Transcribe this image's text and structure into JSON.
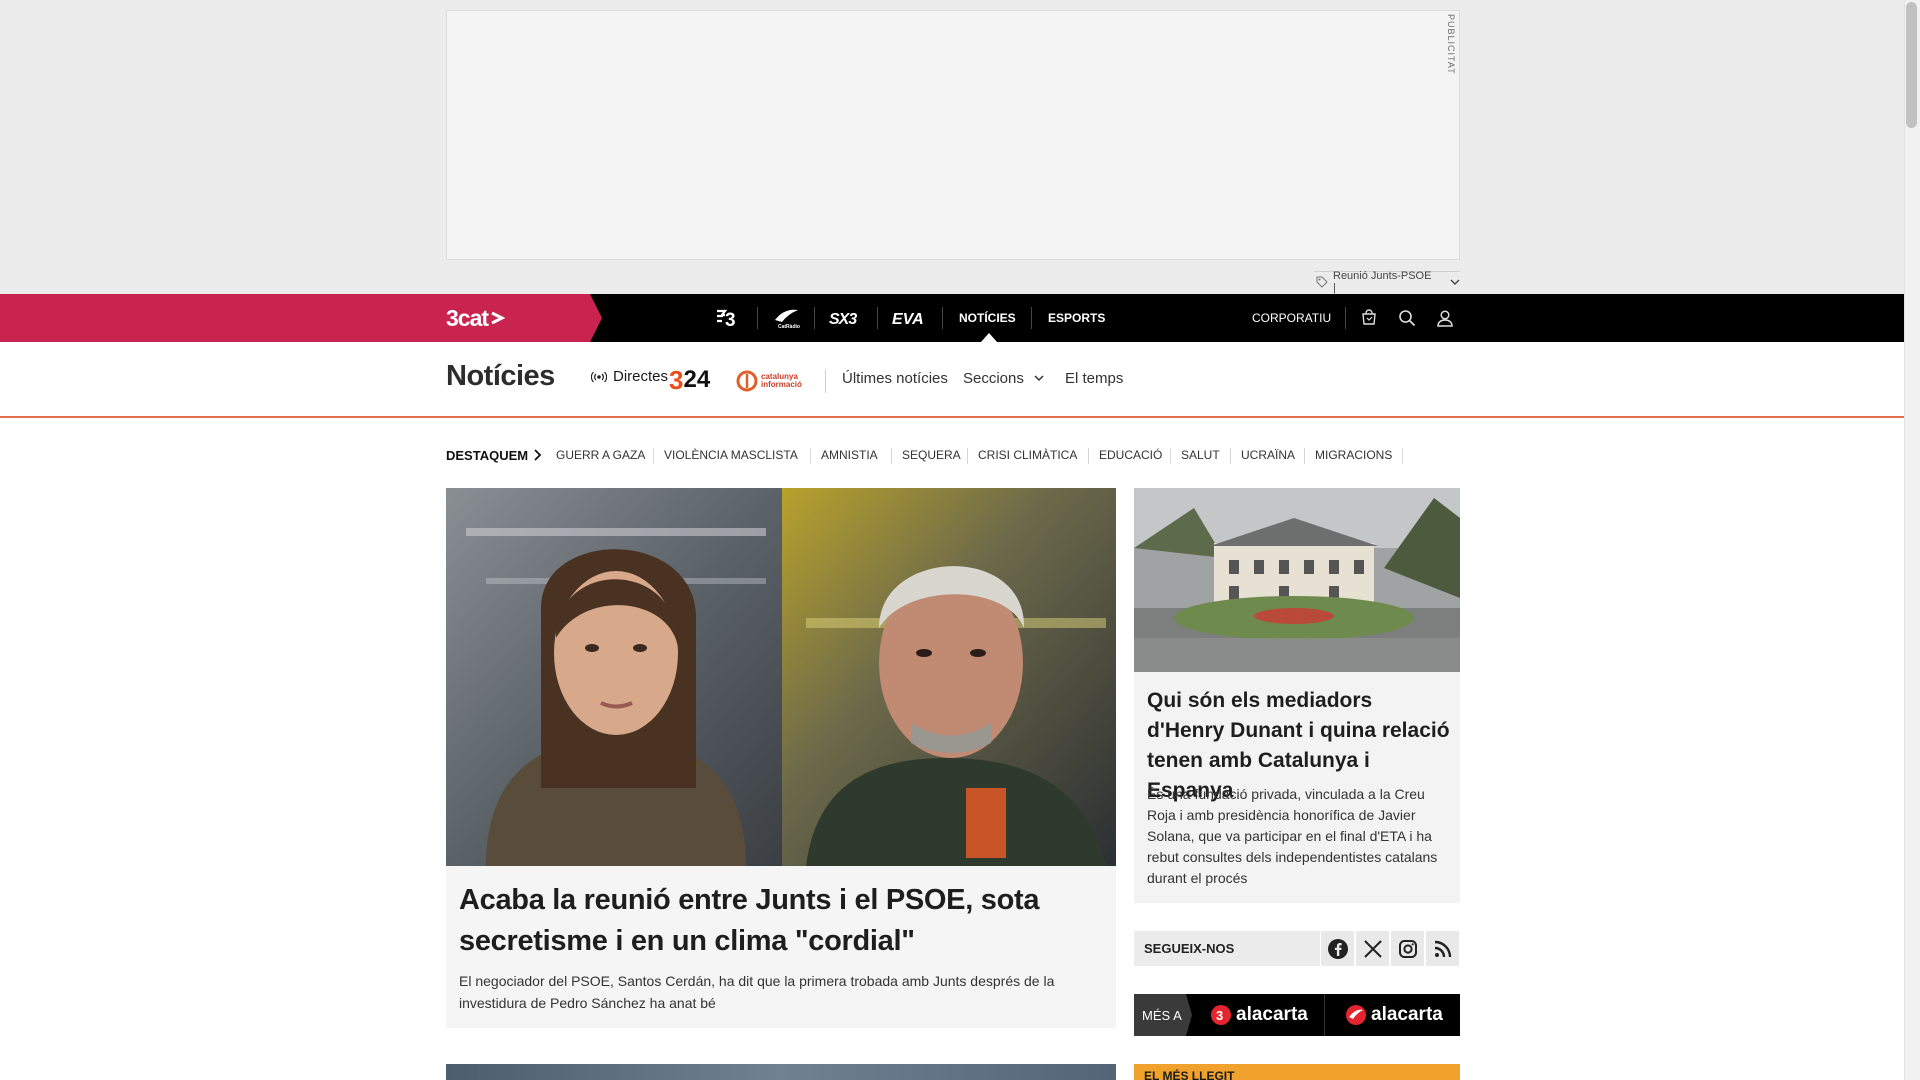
{
  "ad": {
    "label": "PUBLICITAT",
    "tag_text": "Reunió Junts-PSOE |"
  },
  "topnav": {
    "brand": "3cat",
    "channels": [
      {
        "label": "3",
        "name": "tv3"
      },
      {
        "label": "Cat Ràdio",
        "name": "catradio"
      },
      {
        "label": "SX3",
        "name": "sx3"
      },
      {
        "label": "EVA",
        "name": "eva"
      }
    ],
    "links": [
      "NOTÍCIES",
      "ESPORTS"
    ],
    "active": "NOTÍCIES",
    "corporate": "CORPORATIU",
    "icons": [
      "shop-icon",
      "search-icon",
      "user-icon"
    ]
  },
  "section": {
    "title": "Notícies",
    "live_label": "Directes",
    "logo_324": "324",
    "logo_cat_info": [
      "catalunya",
      "informació"
    ],
    "links": [
      "Últimes notícies",
      "Seccions",
      "El temps"
    ]
  },
  "trending": {
    "title": "DESTAQUEM",
    "items": [
      "GUERR A GAZA",
      "VIOLÈNCIA MASCLISTA",
      "AMNISTIA",
      "SEQUERA",
      "CRISI CLIMÀTICA",
      "EDUCACIÓ",
      "SALUT",
      "UCRAÏNA",
      "MIGRACIONS"
    ]
  },
  "main_article": {
    "title": "Acaba la reunió entre Junts i el PSOE, sota secretisme i en un clima \"cordial\"",
    "lead": "El negociador del PSOE, Santos Cerdán, ha dit que la primera trobada amb Junts després de la investidura de Pedro Sánchez ha anat bé"
  },
  "side_article": {
    "title": "Qui són els mediadors d'Henry Dunant i quina relació tenen amb Catalunya i Espanya",
    "lead": "És una fundació privada, vinculada a la Creu Roja i amb presidència honorífica de Javier Solana, que va participar en el final d'ETA i ha rebut consultes dels independentistes catalans durant el procés"
  },
  "follow": {
    "label": "SEGUEIX-NOS",
    "networks": [
      "facebook",
      "x",
      "instagram",
      "rss"
    ]
  },
  "mes_a": {
    "label": "MÉS A",
    "items": [
      "alacarta",
      "alacarta"
    ]
  },
  "next_side": {
    "title": "EL MÉS LLEGIT"
  },
  "colors": {
    "brand_red": "#c8244f",
    "nav_black": "#000000",
    "accent_orange": "#e07050",
    "ranking_orange": "#f0a22c"
  }
}
